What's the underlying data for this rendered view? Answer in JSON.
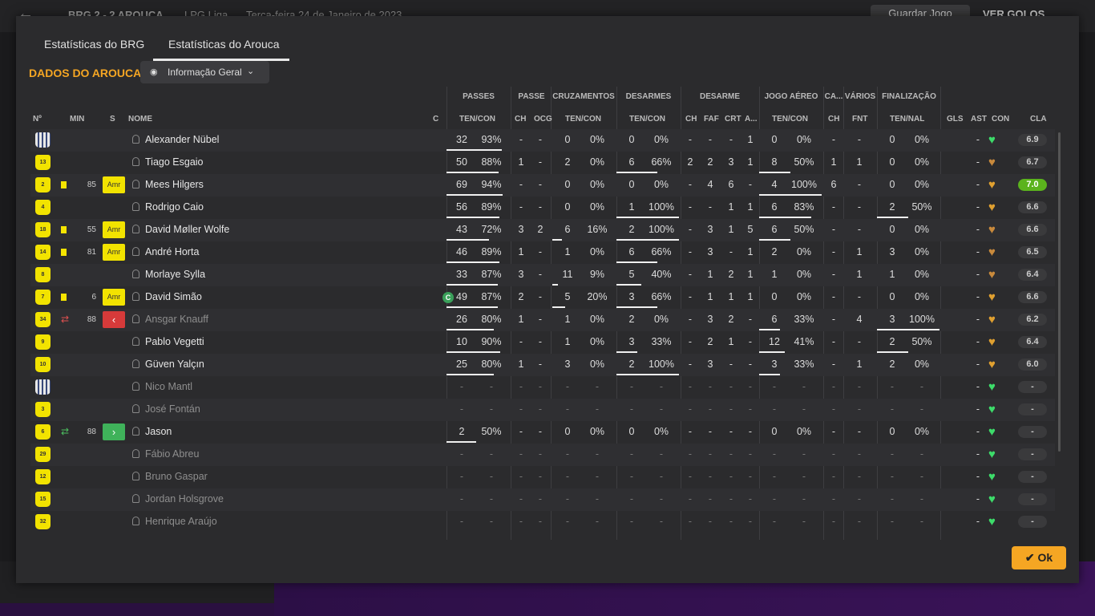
{
  "topbar": {
    "back_icon": "←",
    "match": "BRG 2 - 2 AROUCA",
    "league": "LPG Liga",
    "date": "Terça-feira 24 de Janeiro de 2023",
    "save": "Guardar Jogo",
    "goals": "VER GOLOS"
  },
  "tabs": [
    "Estatísticas do BRG",
    "Estatísticas do Arouca"
  ],
  "section_title": "DADOS DO AROUCA",
  "dropdown": "Informação Geral",
  "groups": [
    "PASSES",
    "PASSE",
    "CRUZAMENTOS",
    "DESARMES",
    "DESARME",
    "JOGO AÉREO",
    "CA...",
    "VÁRIOS",
    "FINALIZAÇÃO"
  ],
  "columns": {
    "num": "Nº",
    "min": "MIN",
    "s": "S",
    "name": "NOME",
    "c": "C",
    "passes": "TEN/CON",
    "ch": "CH",
    "ocg": "OCG",
    "cruz": "TEN/CON",
    "des": "TEN/CON",
    "dch": "CH",
    "faf": "FAF",
    "crt": "CRT",
    "a": "A...",
    "aereo": "TEN/CON",
    "cach": "CH",
    "fnt": "FNT",
    "fin": "TEN/NAL",
    "gls": "GLS",
    "ast": "AST",
    "con": "CON",
    "cla": "CLA"
  },
  "players": [
    {
      "n": "",
      "shirt": "w",
      "min": "",
      "s": "",
      "name": "Alexander Nübel",
      "cap": "",
      "p": [
        "32",
        "93%",
        0.93
      ],
      "pch": "-",
      "ocg": "-",
      "cr": [
        "0",
        "0%",
        0
      ],
      "de": [
        "0",
        "0%",
        0
      ],
      "dch": "-",
      "faf": "-",
      "crt": "-",
      "a": "1",
      "ae": [
        "0",
        "0%",
        0
      ],
      "cach": "-",
      "fnt": "-",
      "fi": [
        "0",
        "0%",
        0
      ],
      "gls": "",
      "ast": "-",
      "con": "#3ddc6a",
      "cla": "6.9",
      "dim": false
    },
    {
      "n": "13",
      "shirt": "y",
      "min": "",
      "s": "",
      "name": "Tiago Esgaio",
      "cap": "",
      "p": [
        "50",
        "88%",
        0.88
      ],
      "pch": "1",
      "ocg": "-",
      "cr": [
        "2",
        "0%",
        0
      ],
      "de": [
        "6",
        "66%",
        0.66
      ],
      "dch": "2",
      "faf": "2",
      "crt": "3",
      "a": "1",
      "ae": [
        "8",
        "50%",
        0.5
      ],
      "cach": "1",
      "fnt": "1",
      "fi": [
        "0",
        "0%",
        0
      ],
      "gls": "",
      "ast": "-",
      "con": "#c98a3c",
      "cla": "6.7",
      "dim": false
    },
    {
      "n": "2",
      "shirt": "y",
      "min": "85",
      "s": "Amr",
      "name": "Mees Hilgers",
      "cap": "",
      "p": [
        "69",
        "94%",
        0.94
      ],
      "pch": "-",
      "ocg": "-",
      "cr": [
        "0",
        "0%",
        0
      ],
      "de": [
        "0",
        "0%",
        0
      ],
      "dch": "-",
      "faf": "4",
      "crt": "6",
      "a": "-",
      "ae": [
        "4",
        "100%",
        1
      ],
      "cach": "6",
      "fnt": "-",
      "fi": [
        "0",
        "0%",
        0
      ],
      "gls": "",
      "ast": "-",
      "con": "#e0a030",
      "cla": "7.0",
      "dim": false,
      "card": true
    },
    {
      "n": "4",
      "shirt": "y",
      "min": "",
      "s": "",
      "name": "Rodrigo Caio",
      "cap": "",
      "p": [
        "56",
        "89%",
        0.89
      ],
      "pch": "-",
      "ocg": "-",
      "cr": [
        "0",
        "0%",
        0
      ],
      "de": [
        "1",
        "100%",
        1
      ],
      "dch": "-",
      "faf": "-",
      "crt": "1",
      "a": "1",
      "ae": [
        "6",
        "83%",
        0.83
      ],
      "cach": "-",
      "fnt": "-",
      "fi": [
        "2",
        "50%",
        0.5
      ],
      "gls": "",
      "ast": "-",
      "con": "#e0a030",
      "cla": "6.6",
      "dim": false
    },
    {
      "n": "18",
      "shirt": "y",
      "min": "55",
      "s": "Amr",
      "name": "David Møller Wolfe",
      "cap": "",
      "p": [
        "43",
        "72%",
        0.72
      ],
      "pch": "3",
      "ocg": "2",
      "cr": [
        "6",
        "16%",
        0.16
      ],
      "de": [
        "2",
        "100%",
        1
      ],
      "dch": "-",
      "faf": "3",
      "crt": "1",
      "a": "5",
      "ae": [
        "6",
        "50%",
        0.5
      ],
      "cach": "-",
      "fnt": "-",
      "fi": [
        "0",
        "0%",
        0
      ],
      "gls": "",
      "ast": "-",
      "con": "#c98a3c",
      "cla": "6.6",
      "dim": false,
      "card": true
    },
    {
      "n": "14",
      "shirt": "y",
      "min": "81",
      "s": "Amr",
      "name": "André Horta",
      "cap": "",
      "p": [
        "46",
        "89%",
        0.89
      ],
      "pch": "1",
      "ocg": "-",
      "cr": [
        "1",
        "0%",
        0
      ],
      "de": [
        "6",
        "66%",
        0.66
      ],
      "dch": "-",
      "faf": "3",
      "crt": "-",
      "a": "1",
      "ae": [
        "2",
        "0%",
        0
      ],
      "cach": "-",
      "fnt": "1",
      "fi": [
        "3",
        "0%",
        0
      ],
      "gls": "",
      "ast": "-",
      "con": "#c98a3c",
      "cla": "6.5",
      "dim": false,
      "card": true
    },
    {
      "n": "8",
      "shirt": "y",
      "min": "",
      "s": "",
      "name": "Morlaye Sylla",
      "cap": "",
      "p": [
        "33",
        "87%",
        0.87
      ],
      "pch": "3",
      "ocg": "-",
      "cr": [
        "11",
        "9%",
        0.09
      ],
      "de": [
        "5",
        "40%",
        0.4
      ],
      "dch": "-",
      "faf": "1",
      "crt": "2",
      "a": "1",
      "ae": [
        "1",
        "0%",
        0
      ],
      "cach": "-",
      "fnt": "1",
      "fi": [
        "1",
        "0%",
        0
      ],
      "gls": "",
      "ast": "-",
      "con": "#c98a3c",
      "cla": "6.4",
      "dim": false
    },
    {
      "n": "7",
      "shirt": "y",
      "min": "6",
      "s": "Amr",
      "name": "David Simão",
      "cap": "C",
      "p": [
        "49",
        "87%",
        0.87
      ],
      "pch": "2",
      "ocg": "-",
      "cr": [
        "5",
        "20%",
        0.2
      ],
      "de": [
        "3",
        "66%",
        0.66
      ],
      "dch": "-",
      "faf": "1",
      "crt": "1",
      "a": "1",
      "ae": [
        "0",
        "0%",
        0
      ],
      "cach": "-",
      "fnt": "-",
      "fi": [
        "0",
        "0%",
        0
      ],
      "gls": "",
      "ast": "-",
      "con": "#e0a030",
      "cla": "6.6",
      "dim": false,
      "card": true
    },
    {
      "n": "34",
      "shirt": "y",
      "min": "88",
      "s": "out",
      "name": "Ansgar Knauff",
      "cap": "",
      "p": [
        "26",
        "80%",
        0.8
      ],
      "pch": "1",
      "ocg": "-",
      "cr": [
        "1",
        "0%",
        0
      ],
      "de": [
        "2",
        "0%",
        0
      ],
      "dch": "-",
      "faf": "3",
      "crt": "2",
      "a": "-",
      "ae": [
        "6",
        "33%",
        0.33
      ],
      "cach": "-",
      "fnt": "4",
      "fi": [
        "3",
        "100%",
        1
      ],
      "gls": "",
      "ast": "-",
      "con": "#e0a030",
      "cla": "6.2",
      "dim": true,
      "sub": "out"
    },
    {
      "n": "9",
      "shirt": "y",
      "min": "",
      "s": "",
      "name": "Pablo Vegetti",
      "cap": "",
      "p": [
        "10",
        "90%",
        0.9
      ],
      "pch": "-",
      "ocg": "-",
      "cr": [
        "1",
        "0%",
        0
      ],
      "de": [
        "3",
        "33%",
        0.33
      ],
      "dch": "-",
      "faf": "2",
      "crt": "1",
      "a": "-",
      "ae": [
        "12",
        "41%",
        0.41
      ],
      "cach": "-",
      "fnt": "-",
      "fi": [
        "2",
        "50%",
        0.5
      ],
      "gls": "",
      "ast": "-",
      "con": "#e0a030",
      "cla": "6.4",
      "dim": false
    },
    {
      "n": "10",
      "shirt": "y",
      "min": "",
      "s": "",
      "name": "Güven Yalçın",
      "cap": "",
      "p": [
        "25",
        "80%",
        0.8
      ],
      "pch": "1",
      "ocg": "-",
      "cr": [
        "3",
        "0%",
        0
      ],
      "de": [
        "2",
        "100%",
        1
      ],
      "dch": "-",
      "faf": "3",
      "crt": "-",
      "a": "-",
      "ae": [
        "3",
        "33%",
        0.33
      ],
      "cach": "-",
      "fnt": "1",
      "fi": [
        "2",
        "0%",
        0
      ],
      "gls": "",
      "ast": "-",
      "con": "#e0a030",
      "cla": "6.0",
      "dim": false
    },
    {
      "n": "",
      "shirt": "w",
      "min": "",
      "s": "",
      "name": "Nico Mantl",
      "cap": "",
      "p": [
        "-",
        "-",
        0
      ],
      "pch": "-",
      "ocg": "-",
      "cr": [
        "-",
        "-",
        0
      ],
      "de": [
        "-",
        "-",
        0
      ],
      "dch": "-",
      "faf": "-",
      "crt": "-",
      "a": "-",
      "ae": [
        "-",
        "-",
        0
      ],
      "cach": "-",
      "fnt": "-",
      "fi": [
        "-",
        "-",
        0
      ],
      "gls": "",
      "ast": "-",
      "con": "#3ddc6a",
      "cla": "-",
      "dim": true,
      "empty": true
    },
    {
      "n": "3",
      "shirt": "y",
      "min": "",
      "s": "",
      "name": "José Fontán",
      "cap": "",
      "p": [
        "-",
        "-",
        0
      ],
      "pch": "-",
      "ocg": "-",
      "cr": [
        "-",
        "-",
        0
      ],
      "de": [
        "-",
        "-",
        0
      ],
      "dch": "-",
      "faf": "-",
      "crt": "-",
      "a": "-",
      "ae": [
        "-",
        "-",
        0
      ],
      "cach": "-",
      "fnt": "-",
      "fi": [
        "-",
        "-",
        0
      ],
      "gls": "",
      "ast": "-",
      "con": "#3ddc6a",
      "cla": "-",
      "dim": true,
      "empty": true
    },
    {
      "n": "6",
      "shirt": "y",
      "min": "88",
      "s": "in",
      "name": "Jason",
      "cap": "",
      "p": [
        "2",
        "50%",
        0.5
      ],
      "pch": "-",
      "ocg": "-",
      "cr": [
        "0",
        "0%",
        0
      ],
      "de": [
        "0",
        "0%",
        0
      ],
      "dch": "-",
      "faf": "-",
      "crt": "-",
      "a": "-",
      "ae": [
        "0",
        "0%",
        0
      ],
      "cach": "-",
      "fnt": "-",
      "fi": [
        "0",
        "0%",
        0
      ],
      "gls": "",
      "ast": "-",
      "con": "#3ddc6a",
      "cla": "-",
      "dim": false,
      "sub": "in"
    },
    {
      "n": "29",
      "shirt": "y",
      "min": "",
      "s": "",
      "name": "Fábio Abreu",
      "cap": "",
      "p": [
        "-",
        "-",
        0
      ],
      "pch": "-",
      "ocg": "-",
      "cr": [
        "-",
        "-",
        0
      ],
      "de": [
        "-",
        "-",
        0
      ],
      "dch": "-",
      "faf": "-",
      "crt": "-",
      "a": "-",
      "ae": [
        "-",
        "-",
        0
      ],
      "cach": "-",
      "fnt": "-",
      "fi": [
        "-",
        "-",
        0
      ],
      "gls": "",
      "ast": "-",
      "con": "#3ddc6a",
      "cla": "-",
      "dim": true,
      "empty": true
    },
    {
      "n": "12",
      "shirt": "y",
      "min": "",
      "s": "",
      "name": "Bruno Gaspar",
      "cap": "",
      "p": [
        "-",
        "-",
        0
      ],
      "pch": "-",
      "ocg": "-",
      "cr": [
        "-",
        "-",
        0
      ],
      "de": [
        "-",
        "-",
        0
      ],
      "dch": "-",
      "faf": "-",
      "crt": "-",
      "a": "-",
      "ae": [
        "-",
        "-",
        0
      ],
      "cach": "-",
      "fnt": "-",
      "fi": [
        "-",
        "-",
        0
      ],
      "gls": "",
      "ast": "-",
      "con": "#3ddc6a",
      "cla": "-",
      "dim": true,
      "empty": true
    },
    {
      "n": "15",
      "shirt": "y",
      "min": "",
      "s": "",
      "name": "Jordan Holsgrove",
      "cap": "",
      "p": [
        "-",
        "-",
        0
      ],
      "pch": "-",
      "ocg": "-",
      "cr": [
        "-",
        "-",
        0
      ],
      "de": [
        "-",
        "-",
        0
      ],
      "dch": "-",
      "faf": "-",
      "crt": "-",
      "a": "-",
      "ae": [
        "-",
        "-",
        0
      ],
      "cach": "-",
      "fnt": "-",
      "fi": [
        "-",
        "-",
        0
      ],
      "gls": "",
      "ast": "-",
      "con": "#3ddc6a",
      "cla": "-",
      "dim": true,
      "empty": true
    },
    {
      "n": "32",
      "shirt": "y",
      "min": "",
      "s": "",
      "name": "Henrique Araújo",
      "cap": "",
      "p": [
        "-",
        "-",
        0
      ],
      "pch": "-",
      "ocg": "-",
      "cr": [
        "-",
        "-",
        0
      ],
      "de": [
        "-",
        "-",
        0
      ],
      "dch": "-",
      "faf": "-",
      "crt": "-",
      "a": "-",
      "ae": [
        "-",
        "-",
        0
      ],
      "cach": "-",
      "fnt": "-",
      "fi": [
        "-",
        "-",
        0
      ],
      "gls": "",
      "ast": "-",
      "con": "#3ddc6a",
      "cla": "-",
      "dim": true,
      "empty": true
    }
  ],
  "ok_button": "Ok"
}
